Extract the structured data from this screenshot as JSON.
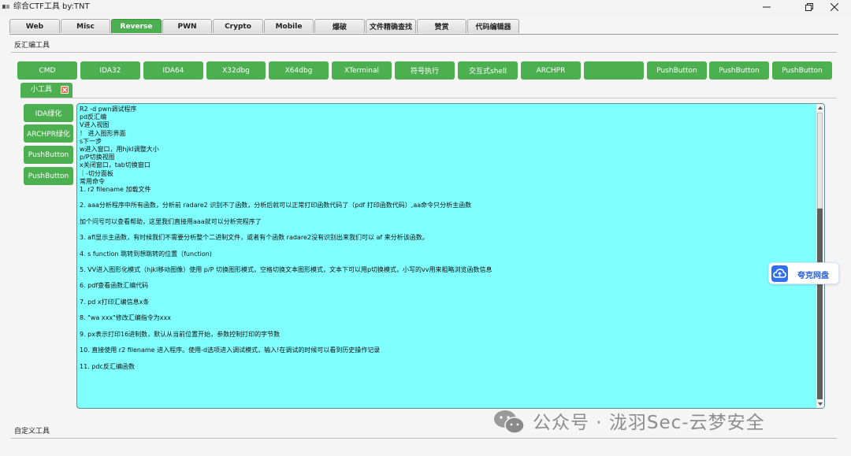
{
  "window": {
    "title": "综合CTF工具   by:TNT"
  },
  "tabs": [
    "Web",
    "Misc",
    "Reverse",
    "PWN",
    "Crypto",
    "Mobile",
    "爆破",
    "文件精确查找",
    "赞赏",
    "代码编辑器"
  ],
  "active_tab": "Reverse",
  "groups": {
    "top": "反汇编工具",
    "bottom": "自定义工具"
  },
  "tool_buttons": [
    "CMD",
    "IDA32",
    "IDA64",
    "X32dbg",
    "X64dbg",
    "XTerminal",
    "符号执行",
    "交互式shell",
    "ARCHPR",
    "",
    "PushButton",
    "PushButton",
    "PushButton"
  ],
  "subtab": {
    "label": "小工具"
  },
  "side_buttons": [
    "IDA绿化",
    "ARCHPR绿化",
    "PushButton",
    "PushButton"
  ],
  "editor": {
    "lines": [
      "R2 -d pwn调试程序",
      "pd反汇编",
      "V进入视图",
      "！ 进入图形界面",
      "s下一步",
      "w进入窗口，用hjkl调整大小",
      "p/P切换视图",
      "x关闭窗口，tab切换窗口",
      "｜-切分面板",
      "常用命令",
      "1. r2 filename 加载文件",
      "",
      "2. aaa分析程序中所有函数，分析前 radare2 识别不了函数，分析后就可以正常打印函数代码了（pdf 打印函数代码）,aa命令只分析主函数",
      "",
      "加个问号可以查看帮助，这里我们直接用aaa就可以分析完程序了",
      "",
      "3. afl显示主函数，有时候我们不需要分析整个二进制文件，或者有个函数 radare2没有识别出来我们可以 af 来分析该函数。",
      "",
      "4. s function 跳转到想跳转的位置（function)",
      "",
      "5. VV进入图形化模式（hjkl移动图像）使用 p/P 切换图形模式，空格切换文本图形模式，文本下可以用p切换模式，小写的vv用来粗略浏览函数信息",
      "",
      "6. pdf查看函数汇编代码",
      "",
      "7. pd x打印汇编信息x条",
      "",
      "8. \"wa xxx\"修改汇编指令为xxx",
      "",
      "9. px表示打印16进制数，默认从当前位置开始，参数控制打印的字节数",
      "",
      "10. 直接使用 r2 filename 进入程序。使用-d选项进入调试模式，输入!在调试的时候可以看到历史操作记录",
      "",
      "11. pdc反汇编函数"
    ]
  },
  "cloud_widget": {
    "label": "夸克网盘"
  },
  "watermark": {
    "text": "公众号 · 泷羽Sec-云梦安全"
  },
  "colors": {
    "accent": "#4caf50",
    "editor_bg": "#80ffff",
    "cloud": "#2f6ff0"
  },
  "icons": [
    "app-icon",
    "minimize-icon",
    "restore-icon",
    "close-icon",
    "close-tab-icon",
    "cloud-icon",
    "wechat-icon"
  ]
}
